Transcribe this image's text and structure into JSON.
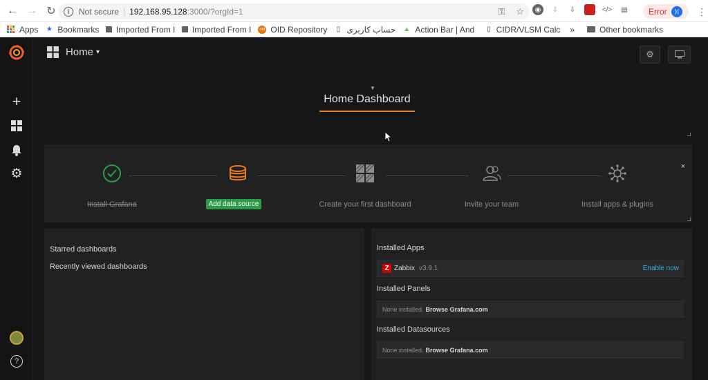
{
  "browser": {
    "not_secure": "Not secure",
    "url_host": "192.168.95.128",
    "url_path": ":3000/?orgId=1",
    "error_label": "Error"
  },
  "bookmarks": [
    {
      "label": "Apps",
      "icon": "apps-grid-icon"
    },
    {
      "label": "Bookmarks",
      "icon": "star-icon"
    },
    {
      "label": "Imported From I",
      "icon": "folder-icon"
    },
    {
      "label": "Imported From I",
      "icon": "folder-icon"
    },
    {
      "label": "OID Repository",
      "icon": "oid-icon"
    },
    {
      "label": "حساب کاربری",
      "icon": "page-icon"
    },
    {
      "label": "Action Bar | And",
      "icon": "android-icon"
    },
    {
      "label": "CIDR/VLSM Calc",
      "icon": "page-icon"
    }
  ],
  "bookmarks_overflow": "»",
  "other_bookmarks": "Other bookmarks",
  "header": {
    "home_label": "Home",
    "home_caret": "▾"
  },
  "dashboard": {
    "title": "Home Dashboard"
  },
  "getting_started": {
    "steps": [
      {
        "label": "Install Grafana",
        "done": true
      },
      {
        "label": "Add data source",
        "active": true
      },
      {
        "label": "Create your first dashboard"
      },
      {
        "label": "Invite your team"
      },
      {
        "label": "Install apps & plugins"
      }
    ],
    "close": "×"
  },
  "left_panel": {
    "starred": "Starred dashboards",
    "recent": "Recently viewed dashboards"
  },
  "right_panel": {
    "installed_apps": "Installed Apps",
    "app_name": "Zabbix",
    "app_version": "v3.9.1",
    "app_action": "Enable now",
    "installed_panels": "Installed Panels",
    "panels_none": "None installed.",
    "panels_browse": "Browse Grafana.com",
    "installed_datasources": "Installed Datasources",
    "ds_none": "None installed.",
    "ds_browse": "Browse Grafana.com"
  },
  "colors": {
    "accent_orange": "#eb7b18",
    "success_green": "#299c46",
    "link_blue": "#33b5e5",
    "zabbix_red": "#d40000"
  }
}
